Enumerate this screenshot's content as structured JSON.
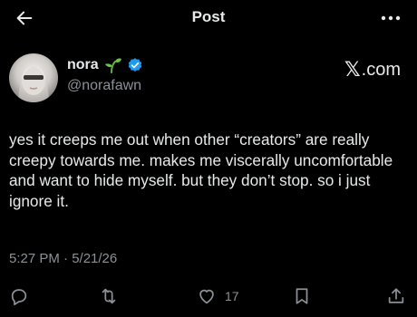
{
  "header": {
    "title": "Post",
    "back_icon": "arrow-left-icon",
    "more_icon": "more-horizontal-icon"
  },
  "author": {
    "display_name": "nora",
    "handle": "@norafawn",
    "emoji_icon": "seedling-icon",
    "verified_icon": "verified-badge-icon",
    "verified_color": "#1d9bf0"
  },
  "watermark": {
    "x_logo": "𝕏",
    "suffix": ".com"
  },
  "tweet": {
    "text": "yes it creeps me out when other “creators” are really creepy towards me. makes me viscerally uncomfortable and want to hide myself. but they don’t stop. so i just ignore it.",
    "timestamp": "5:27 PM · 5/21/26"
  },
  "actions": {
    "reply_icon": "reply-icon",
    "retweet_icon": "retweet-icon",
    "like_icon": "heart-icon",
    "like_count": "17",
    "bookmark_icon": "bookmark-icon",
    "share_icon": "share-icon"
  },
  "colors": {
    "background": "#000000",
    "text": "#e7e9ea",
    "muted": "#8b9096",
    "accent": "#1d9bf0"
  }
}
